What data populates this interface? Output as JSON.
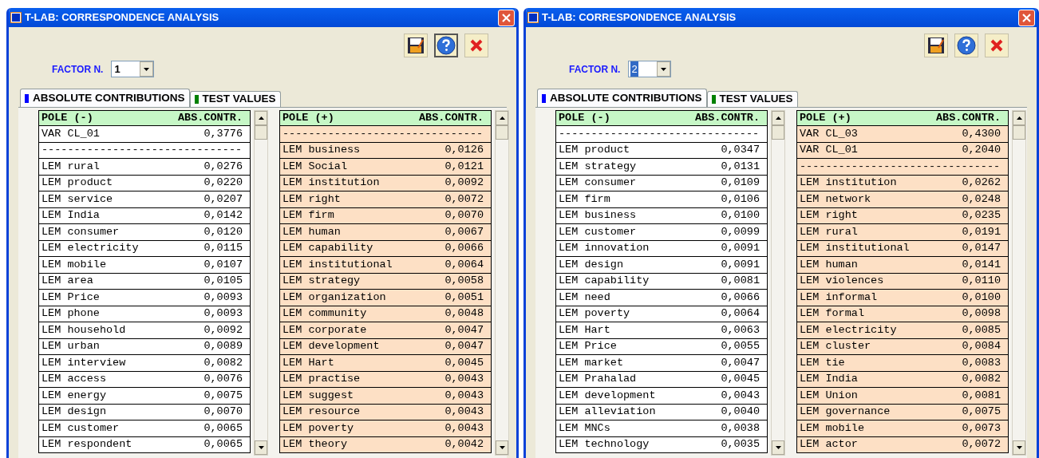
{
  "windows": [
    {
      "title": "T-LAB: CORRESPONDENCE ANALYSIS",
      "help_focused": true,
      "factor": {
        "label": "FACTOR N.",
        "value": "1",
        "highlighted": false
      },
      "tabs": [
        {
          "label": "ABSOLUTE CONTRIBUTIONS",
          "selected": true,
          "color": "#0000ff"
        },
        {
          "label": "TEST VALUES",
          "selected": false,
          "color": "#008000"
        }
      ],
      "tables": [
        {
          "pole": "POLE (-)",
          "column": "ABS.CONTR.",
          "kind": "negative",
          "rows": [
            {
              "label": "VAR CL_01",
              "value": "0,3776"
            },
            {
              "label": "-------------------------------"
            },
            {
              "label": "LEM rural",
              "value": "0,0276"
            },
            {
              "label": "LEM product",
              "value": "0,0220"
            },
            {
              "label": "LEM service",
              "value": "0,0207"
            },
            {
              "label": "LEM India",
              "value": "0,0142"
            },
            {
              "label": "LEM consumer",
              "value": "0,0120"
            },
            {
              "label": "LEM electricity",
              "value": "0,0115"
            },
            {
              "label": "LEM mobile",
              "value": "0,0107"
            },
            {
              "label": "LEM area",
              "value": "0,0105"
            },
            {
              "label": "LEM Price",
              "value": "0,0093"
            },
            {
              "label": "LEM phone",
              "value": "0,0093"
            },
            {
              "label": "LEM household",
              "value": "0,0092"
            },
            {
              "label": "LEM urban",
              "value": "0,0089"
            },
            {
              "label": "LEM interview",
              "value": "0,0082"
            },
            {
              "label": "LEM access",
              "value": "0,0076"
            },
            {
              "label": "LEM energy",
              "value": "0,0075"
            },
            {
              "label": "LEM design",
              "value": "0,0070"
            },
            {
              "label": "LEM customer",
              "value": "0,0065"
            },
            {
              "label": "LEM respondent",
              "value": "0,0065"
            }
          ]
        },
        {
          "pole": "POLE (+)",
          "column": "ABS.CONTR.",
          "kind": "positive",
          "rows": [
            {
              "label": "-------------------------------"
            },
            {
              "label": "LEM business",
              "value": "0,0126"
            },
            {
              "label": "LEM Social",
              "value": "0,0121"
            },
            {
              "label": "LEM institution",
              "value": "0,0092"
            },
            {
              "label": "LEM right",
              "value": "0,0072"
            },
            {
              "label": "LEM firm",
              "value": "0,0070"
            },
            {
              "label": "LEM human",
              "value": "0,0067"
            },
            {
              "label": "LEM capability",
              "value": "0,0066"
            },
            {
              "label": "LEM institutional",
              "value": "0,0064"
            },
            {
              "label": "LEM strategy",
              "value": "0,0058"
            },
            {
              "label": "LEM organization",
              "value": "0,0051"
            },
            {
              "label": "LEM community",
              "value": "0,0048"
            },
            {
              "label": "LEM corporate",
              "value": "0,0047"
            },
            {
              "label": "LEM development",
              "value": "0,0047"
            },
            {
              "label": "LEM Hart",
              "value": "0,0045"
            },
            {
              "label": "LEM practise",
              "value": "0,0043"
            },
            {
              "label": "LEM suggest",
              "value": "0,0043"
            },
            {
              "label": "LEM resource",
              "value": "0,0043"
            },
            {
              "label": "LEM poverty",
              "value": "0,0043"
            },
            {
              "label": "LEM theory",
              "value": "0,0042"
            }
          ]
        }
      ]
    },
    {
      "title": "T-LAB: CORRESPONDENCE ANALYSIS",
      "help_focused": false,
      "factor": {
        "label": "FACTOR N.",
        "value": "2",
        "highlighted": true
      },
      "tabs": [
        {
          "label": "ABSOLUTE CONTRIBUTIONS",
          "selected": true,
          "color": "#0000ff"
        },
        {
          "label": "TEST VALUES",
          "selected": false,
          "color": "#008000"
        }
      ],
      "tables": [
        {
          "pole": "POLE (-)",
          "column": "ABS.CONTR.",
          "kind": "negative",
          "rows": [
            {
              "label": "-------------------------------"
            },
            {
              "label": "LEM product",
              "value": "0,0347"
            },
            {
              "label": "LEM strategy",
              "value": "0,0131"
            },
            {
              "label": "LEM consumer",
              "value": "0,0109"
            },
            {
              "label": "LEM firm",
              "value": "0,0106"
            },
            {
              "label": "LEM business",
              "value": "0,0100"
            },
            {
              "label": "LEM customer",
              "value": "0,0099"
            },
            {
              "label": "LEM innovation",
              "value": "0,0091"
            },
            {
              "label": "LEM design",
              "value": "0,0091"
            },
            {
              "label": "LEM capability",
              "value": "0,0081"
            },
            {
              "label": "LEM need",
              "value": "0,0066"
            },
            {
              "label": "LEM poverty",
              "value": "0,0064"
            },
            {
              "label": "LEM Hart",
              "value": "0,0063"
            },
            {
              "label": "LEM Price",
              "value": "0,0055"
            },
            {
              "label": "LEM market",
              "value": "0,0047"
            },
            {
              "label": "LEM Prahalad",
              "value": "0,0045"
            },
            {
              "label": "LEM development",
              "value": "0,0043"
            },
            {
              "label": "LEM alleviation",
              "value": "0,0040"
            },
            {
              "label": "LEM MNCs",
              "value": "0,0038"
            },
            {
              "label": "LEM technology",
              "value": "0,0035"
            }
          ]
        },
        {
          "pole": "POLE (+)",
          "column": "ABS.CONTR.",
          "kind": "positive",
          "rows": [
            {
              "label": "VAR CL_03",
              "value": "0,4300"
            },
            {
              "label": "VAR CL_01",
              "value": "0,2040"
            },
            {
              "label": "-------------------------------"
            },
            {
              "label": "LEM institution",
              "value": "0,0262"
            },
            {
              "label": "LEM network",
              "value": "0,0248"
            },
            {
              "label": "LEM right",
              "value": "0,0235"
            },
            {
              "label": "LEM rural",
              "value": "0,0191"
            },
            {
              "label": "LEM institutional",
              "value": "0,0147"
            },
            {
              "label": "LEM human",
              "value": "0,0141"
            },
            {
              "label": "LEM violences",
              "value": "0,0110"
            },
            {
              "label": "LEM informal",
              "value": "0,0100"
            },
            {
              "label": "LEM formal",
              "value": "0,0098"
            },
            {
              "label": "LEM electricity",
              "value": "0,0085"
            },
            {
              "label": "LEM cluster",
              "value": "0,0084"
            },
            {
              "label": "LEM tie",
              "value": "0,0083"
            },
            {
              "label": "LEM India",
              "value": "0,0082"
            },
            {
              "label": "LEM Union",
              "value": "0,0081"
            },
            {
              "label": "LEM governance",
              "value": "0,0075"
            },
            {
              "label": "LEM mobile",
              "value": "0,0073"
            },
            {
              "label": "LEM actor",
              "value": "0,0072"
            }
          ]
        }
      ]
    }
  ]
}
